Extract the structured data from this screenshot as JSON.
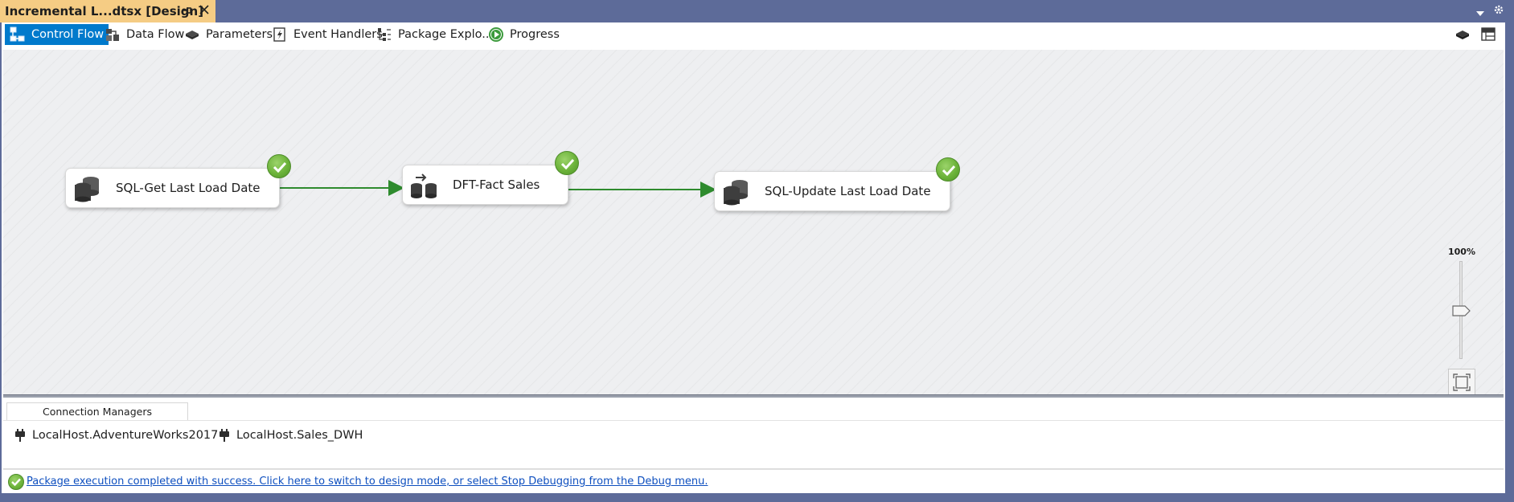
{
  "document_tab": {
    "title": "Incremental L...dtsx [Design]",
    "pin_icon": "pin-icon",
    "close_icon": "close-icon",
    "accent_color": "#f5cc84"
  },
  "designer_tabs": [
    {
      "label": "Control Flow",
      "icon": "control-flow-icon",
      "active": true
    },
    {
      "label": "Data Flow",
      "icon": "data-flow-icon",
      "active": false
    },
    {
      "label": "Parameters",
      "icon": "parameters-icon",
      "active": false
    },
    {
      "label": "Event Handlers",
      "icon": "event-handlers-icon",
      "active": false
    },
    {
      "label": "Package Explo...",
      "icon": "package-explorer-icon",
      "active": false
    },
    {
      "label": "Progress",
      "icon": "progress-play-icon",
      "active": false
    }
  ],
  "toolbar_right": {
    "icons": [
      "variables-icon",
      "ssis-toolbox-icon"
    ]
  },
  "canvas": {
    "tasks": [
      {
        "label": "SQL-Get Last Load Date",
        "icon": "execute-sql-task-icon",
        "status": "success"
      },
      {
        "label": "DFT-Fact Sales",
        "icon": "data-flow-task-icon",
        "status": "success"
      },
      {
        "label": "SQL-Update Last Load Date",
        "icon": "execute-sql-task-icon",
        "status": "success"
      }
    ],
    "precedence_constraint_color": "#2e8b2e",
    "zoom_level": "100%",
    "zoom_value": 1.0
  },
  "connection_managers": {
    "tab_label": "Connection Managers",
    "items": [
      {
        "label": "LocalHost.AdventureWorks2017",
        "icon": "connection-plug-icon"
      },
      {
        "label": "LocalHost.Sales_DWH",
        "icon": "connection-plug-icon"
      }
    ]
  },
  "status_bar": {
    "message": "Package execution completed with success. Click here to switch to design mode, or select Stop Debugging from the Debug menu.",
    "icon": "success-check-icon"
  },
  "colors": {
    "success_green": "#6cb33a",
    "active_tab_blue": "#007acc",
    "chrome": "#5d6b99"
  }
}
